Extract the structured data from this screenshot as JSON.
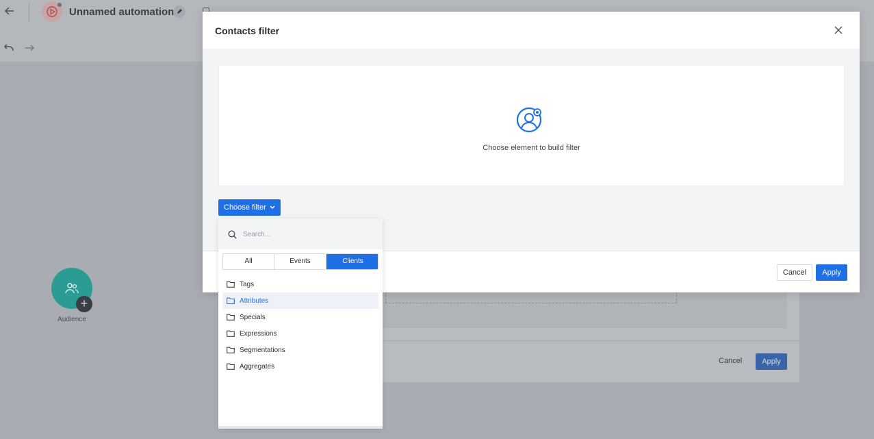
{
  "app": {
    "automation_title": "Unnamed automation",
    "audience_label": "Audience"
  },
  "background_footer": {
    "cancel_label": "Cancel",
    "apply_label": "Apply"
  },
  "modal": {
    "title": "Contacts filter",
    "canvas_hint": "Choose element to build filter",
    "choose_filter_label": "Choose filter",
    "cancel_label": "Cancel",
    "apply_label": "Apply"
  },
  "dropdown": {
    "search_placeholder": "Search...",
    "tabs": [
      {
        "label": "All",
        "active": false
      },
      {
        "label": "Events",
        "active": false
      },
      {
        "label": "Clients",
        "active": true
      }
    ],
    "items": [
      {
        "label": "Tags",
        "selected": false
      },
      {
        "label": "Attributes",
        "selected": true
      },
      {
        "label": "Specials",
        "selected": false
      },
      {
        "label": "Expressions",
        "selected": false
      },
      {
        "label": "Segmentations",
        "selected": false
      },
      {
        "label": "Aggregates",
        "selected": false
      }
    ]
  },
  "colors": {
    "accent": "#1f6fe5",
    "audience_node": "#2a9c93",
    "overlay": "#a9adb3"
  }
}
